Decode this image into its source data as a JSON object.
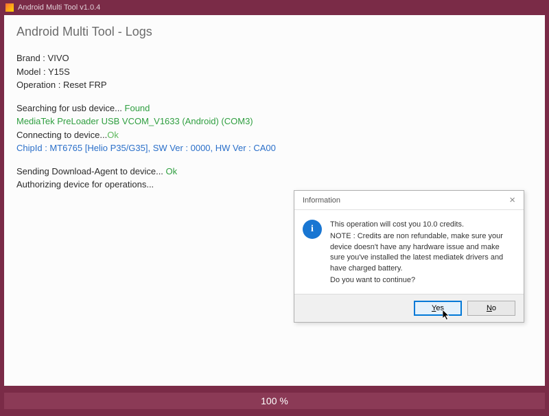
{
  "titlebar": {
    "text": "Android Multi Tool v1.0.4"
  },
  "page": {
    "title": "Android Multi Tool - Logs"
  },
  "logs": {
    "brand_label": "Brand : ",
    "brand_value": "VIVO",
    "model_label": "Model : ",
    "model_value": "Y15S",
    "operation_label": "Operation : ",
    "operation_value": "Reset FRP",
    "searching_prefix": "Searching for usb device... ",
    "searching_status": "Found",
    "device_line": "MediaTek PreLoader USB VCOM_V1633 (Android) (COM3)",
    "connecting_prefix": "Connecting to device...",
    "connecting_status": "Ok",
    "chipid_line": "ChipId : MT6765 [Helio P35/G35], SW Ver : 0000, HW Ver : CA00",
    "sending_prefix": "Sending Download-Agent to device... ",
    "sending_status": "Ok",
    "authorizing_line": "Authorizing device for operations..."
  },
  "dialog": {
    "title": "Information",
    "close_icon": "×",
    "info_glyph": "i",
    "line1": "This operation will cost you 10.0 credits.",
    "line2": "NOTE : Credits are non refundable, make sure your device doesn't have any hardware issue and make sure you've installed the latest mediatek drivers and have charged battery.",
    "line3": "Do you want to continue?",
    "yes_label_pre": "",
    "yes_label_u": "Y",
    "yes_label_post": "es",
    "no_label_pre": "",
    "no_label_u": "N",
    "no_label_post": "o"
  },
  "progress": {
    "text": "100 %"
  }
}
